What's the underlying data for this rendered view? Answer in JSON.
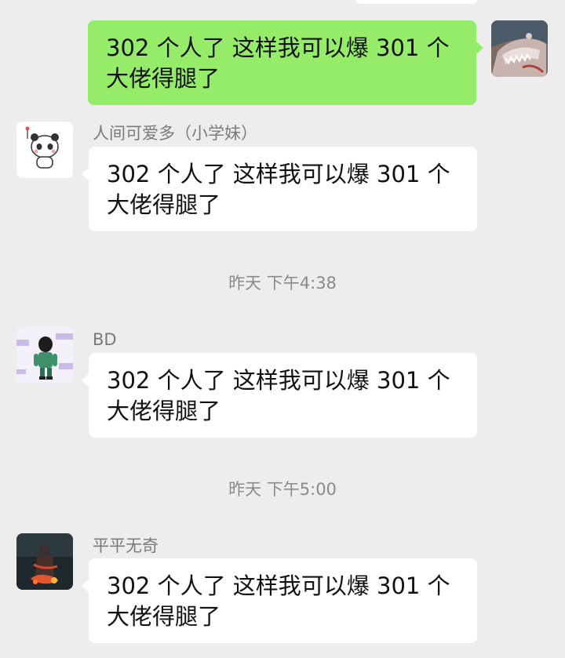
{
  "chat": {
    "outgoing": {
      "text": "302 个人了 这样我可以爆 301 个大佬得腿了"
    },
    "messages": [
      {
        "sender": "人间可爱多（小学妹）",
        "text": "302 个人了 这样我可以爆 301 个大佬得腿了"
      },
      {
        "sender": "BD",
        "text": "302 个人了 这样我可以爆 301 个大佬得腿了"
      },
      {
        "sender": "平平无奇",
        "text": "302 个人了 这样我可以爆 301 个大佬得腿了"
      }
    ],
    "timestamps": [
      "昨天 下午4:38",
      "昨天 下午5:00"
    ]
  },
  "colors": {
    "background": "#ededed",
    "outgoing_bubble": "#95ec69",
    "incoming_bubble": "#ffffff"
  }
}
